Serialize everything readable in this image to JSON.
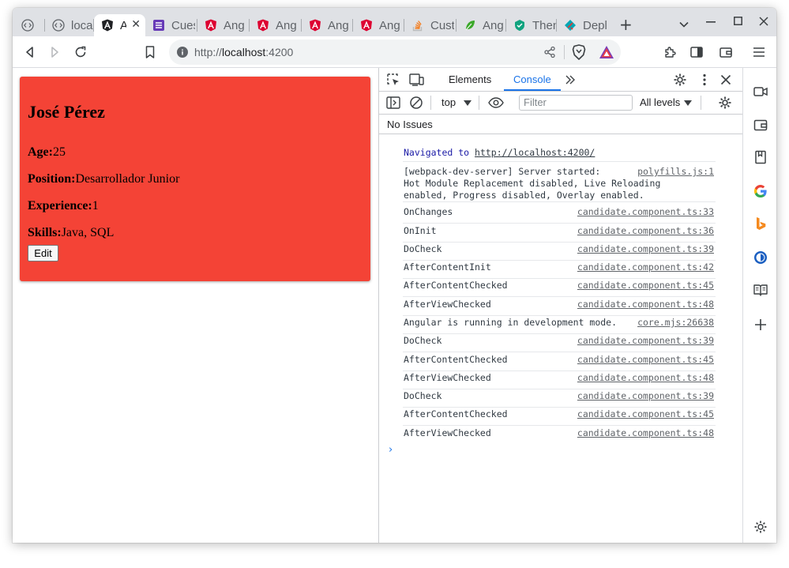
{
  "browser": {
    "tabs": [
      {
        "title": "local",
        "icon": "devtools-code-icon",
        "color": "#5f6368"
      },
      {
        "title": "A",
        "icon": "angular-logo-icon",
        "color": "#202124",
        "active": true
      },
      {
        "title": "Cues",
        "icon": "forms-list-icon",
        "color": "#673ab7"
      },
      {
        "title": "Ang",
        "icon": "angular-shield-icon",
        "color": "#dd0031"
      },
      {
        "title": "Ang",
        "icon": "angular-shield-icon",
        "color": "#dd0031"
      },
      {
        "title": "Ang",
        "icon": "angular-shield-icon",
        "color": "#dd0031"
      },
      {
        "title": "Ang",
        "icon": "angular-shield-icon",
        "color": "#dd0031"
      },
      {
        "title": "Cust",
        "icon": "stackoverflow-icon",
        "color": "#f48024"
      },
      {
        "title": "Ang",
        "icon": "leaf-icon",
        "color": "#3ca82b"
      },
      {
        "title": "Then",
        "icon": "shield-green-icon",
        "color": "#10a37f"
      },
      {
        "title": "Depl",
        "icon": "deploy-icon",
        "color": "#00a7b5"
      }
    ],
    "first_tab_title": "loca",
    "new_tab_label": "+",
    "address": {
      "scheme": "http://",
      "host": "localhost",
      "port": ":4200"
    }
  },
  "candidate": {
    "name": "José Pérez",
    "age_label": "Age:",
    "age": "25",
    "position_label": "Position:",
    "position": "Desarrollador Junior",
    "experience_label": "Experience:",
    "experience": "1",
    "skills_label": "Skills:",
    "skills": "Java, SQL",
    "edit_label": "Edit",
    "card_color": "#f44336"
  },
  "devtools": {
    "tabs": {
      "elements": "Elements",
      "console": "Console"
    },
    "context": "top",
    "filter_placeholder": "Filter",
    "levels": "All levels",
    "issues": "No Issues",
    "navigated_prefix": "Navigated to",
    "navigated_url": "http://localhost:4200/",
    "wds_line1": "[webpack-dev-server] Server started:",
    "wds_line2": "Hot Module Replacement disabled, Live Reloading",
    "wds_line3": "enabled, Progress disabled, Overlay enabled.",
    "wds_source": "polyfills.js:1",
    "logs": [
      {
        "msg": "OnChanges",
        "src": "candidate.component.ts:33"
      },
      {
        "msg": "OnInit",
        "src": "candidate.component.ts:36"
      },
      {
        "msg": "DoCheck",
        "src": "candidate.component.ts:39"
      },
      {
        "msg": "AfterContentInit",
        "src": "candidate.component.ts:42"
      },
      {
        "msg": "AfterContentChecked",
        "src": "candidate.component.ts:45"
      },
      {
        "msg": "AfterViewChecked",
        "src": "candidate.component.ts:48"
      },
      {
        "msg": "Angular is running in development mode.",
        "src": "core.mjs:26638"
      },
      {
        "msg": "DoCheck",
        "src": "candidate.component.ts:39"
      },
      {
        "msg": "AfterContentChecked",
        "src": "candidate.component.ts:45"
      },
      {
        "msg": "AfterViewChecked",
        "src": "candidate.component.ts:48"
      },
      {
        "msg": "DoCheck",
        "src": "candidate.component.ts:39"
      },
      {
        "msg": "AfterContentChecked",
        "src": "candidate.component.ts:45"
      },
      {
        "msg": "AfterViewChecked",
        "src": "candidate.component.ts:48"
      }
    ],
    "prompt": "›",
    "accent": "#1a73e8"
  },
  "side_panel_icons": [
    "video-icon",
    "wallet-icon",
    "bookmarks-icon",
    "google-icon",
    "bing-icon",
    "vpn-icon",
    "reader-icon",
    "add-icon",
    "settings-icon"
  ]
}
